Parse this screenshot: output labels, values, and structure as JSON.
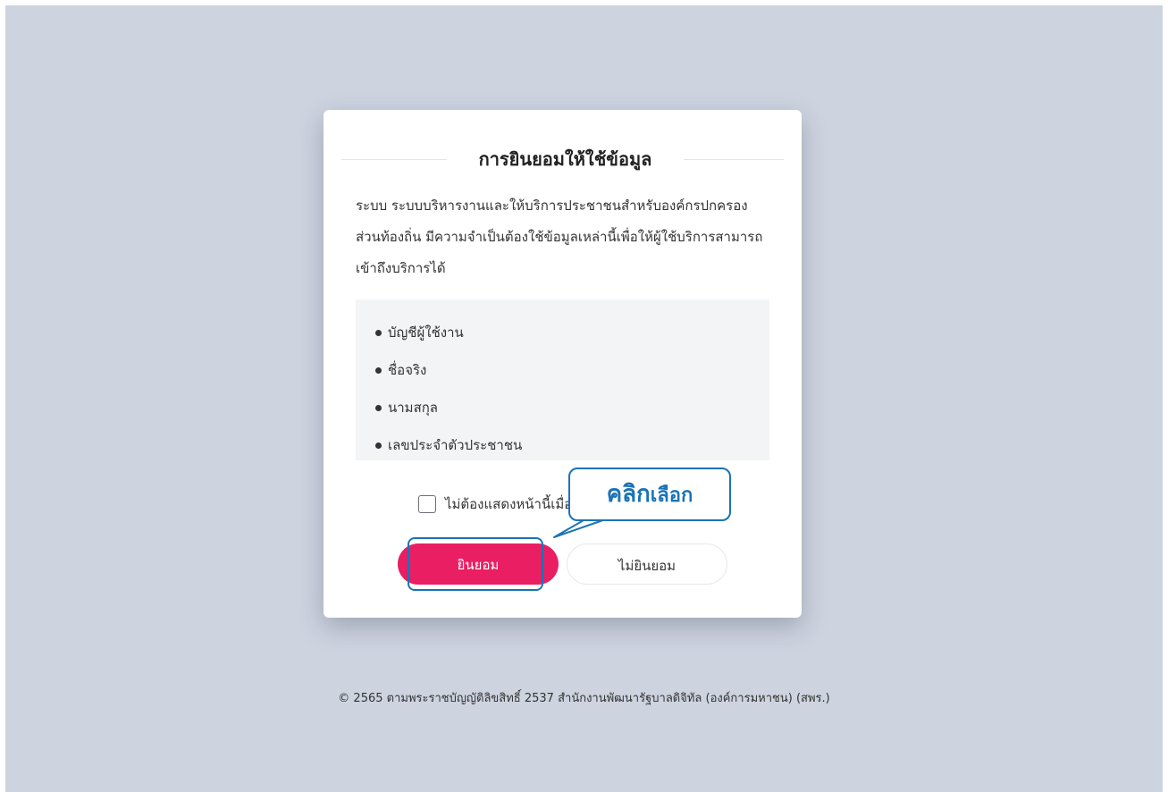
{
  "consent_dialog": {
    "title": "การยินยอมให้ใช้ข้อมูล",
    "description": "ระบบ ระบบบริหารงานและให้บริการประชาชนสำหรับองค์กรปกครองส่วนท้องถิ่น มีความจำเป็นต้องใช้ข้อมูลเหล่านี้เพื่อให้ผู้ใช้บริการสามารถเข้าถึงบริการได้",
    "data_items": [
      "บัญชีผู้ใช้งาน",
      "ชื่อจริง",
      "นามสกุล",
      "เลขประจำตัวประชาชน"
    ],
    "checkbox_label": "ไม่ต้องแสดงหน้านี้เมื่อ",
    "checkbox_checked": false,
    "accept_label": "ยินยอม",
    "decline_label": "ไม่ยินยอม"
  },
  "annotation": {
    "callout_text_bold": "คลิก",
    "callout_text": "เลือก",
    "color": "#1a73b8"
  },
  "footer": {
    "copyright": "© 2565 ตามพระราชบัญญัติลิขสิทธิ์ 2537 สำนักงานพัฒนารัฐบาลดิจิทัล (องค์การมหาชน) (สพร.)"
  },
  "colors": {
    "background": "#cdd3df",
    "accept_button": "#e91e63",
    "annotation": "#1a73b8"
  }
}
